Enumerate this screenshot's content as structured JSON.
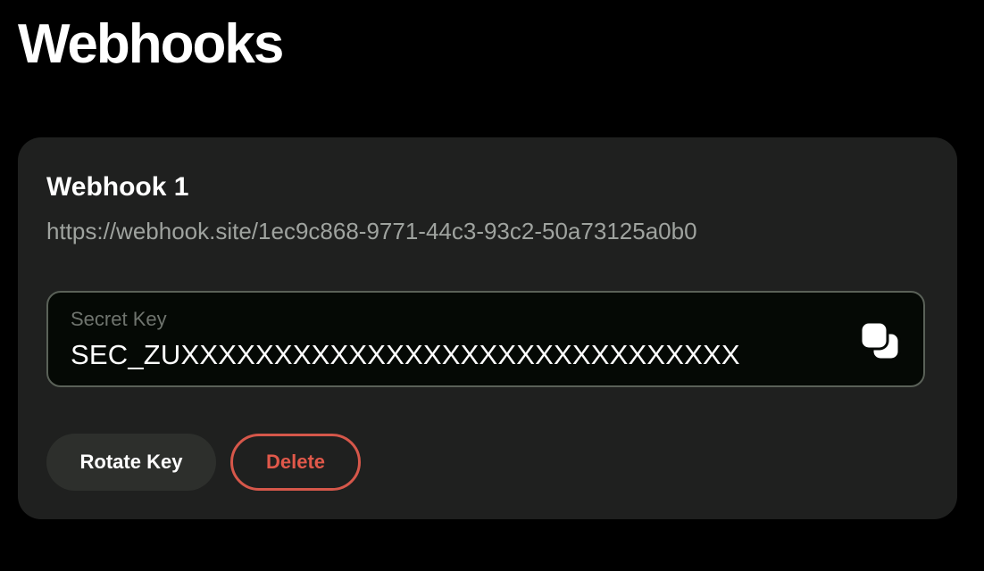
{
  "page": {
    "title": "Webhooks"
  },
  "webhook": {
    "name": "Webhook 1",
    "url": "https://webhook.site/1ec9c868-9771-44c3-93c2-50a73125a0b0",
    "secret_key_label": "Secret Key",
    "secret_key_value": "SEC_ZUXXXXXXXXXXXXXXXXXXXXXXXXXXXXXX",
    "copy_icon": "copy-icon",
    "rotate_label": "Rotate Key",
    "delete_label": "Delete"
  },
  "colors": {
    "background": "#000000",
    "card": "#1f201f",
    "field_background": "#050905",
    "field_border": "#5a6158",
    "muted_text": "#9fa39f",
    "danger": "#d6574a",
    "secondary_button": "#2d2f2c"
  }
}
